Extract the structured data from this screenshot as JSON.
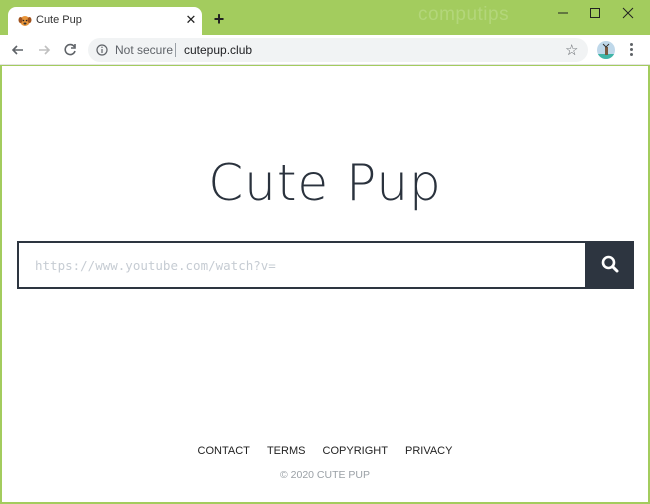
{
  "browser": {
    "tab": {
      "title": "Cute Pup",
      "favicon": "dog-favicon",
      "close_icon": "✕"
    },
    "new_tab_icon": "+",
    "watermark": "computips",
    "window_controls": {
      "minimize": "–",
      "maximize": "☐",
      "close": "✕"
    },
    "nav": {
      "back": "←",
      "forward": "→",
      "reload": "↻"
    },
    "omnibox": {
      "security_label": "Not secure",
      "url": "cutepup.club"
    },
    "star_icon": "☆",
    "accent_color": "#a3cc5e"
  },
  "page": {
    "title": "Cute Pup",
    "search": {
      "placeholder": "https://www.youtube.com/watch?v=",
      "value": "",
      "button_icon": "search-icon"
    },
    "footer": {
      "links": [
        "CONTACT",
        "TERMS",
        "COPYRIGHT",
        "PRIVACY"
      ],
      "copyright": "© 2020 CUTE PUP"
    },
    "colors": {
      "dark": "#2d3540",
      "placeholder": "#c6ccd3"
    }
  }
}
